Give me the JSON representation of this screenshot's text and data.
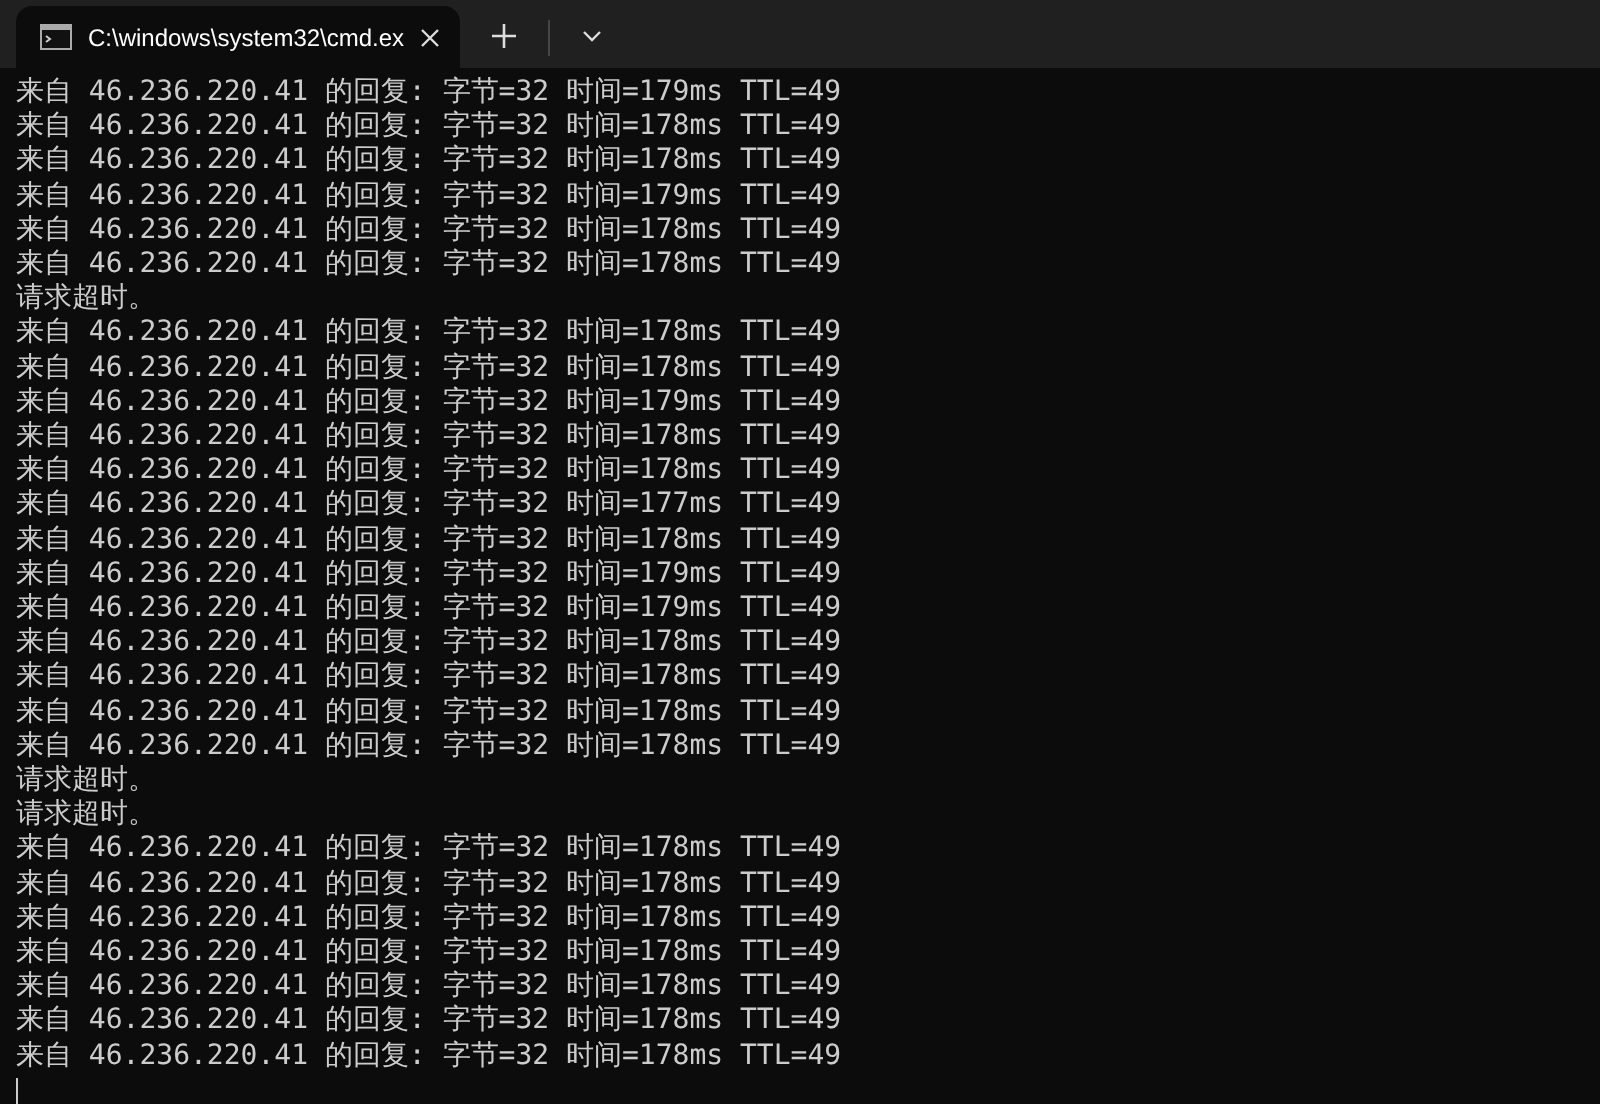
{
  "tabs": [
    {
      "title": "C:\\windows\\system32\\cmd.ex",
      "selected": true
    }
  ],
  "lines": [
    "来自 46.236.220.41 的回复: 字节=32 时间=179ms TTL=49",
    "来自 46.236.220.41 的回复: 字节=32 时间=178ms TTL=49",
    "来自 46.236.220.41 的回复: 字节=32 时间=178ms TTL=49",
    "来自 46.236.220.41 的回复: 字节=32 时间=179ms TTL=49",
    "来自 46.236.220.41 的回复: 字节=32 时间=178ms TTL=49",
    "来自 46.236.220.41 的回复: 字节=32 时间=178ms TTL=49",
    "请求超时。",
    "来自 46.236.220.41 的回复: 字节=32 时间=178ms TTL=49",
    "来自 46.236.220.41 的回复: 字节=32 时间=178ms TTL=49",
    "来自 46.236.220.41 的回复: 字节=32 时间=179ms TTL=49",
    "来自 46.236.220.41 的回复: 字节=32 时间=178ms TTL=49",
    "来自 46.236.220.41 的回复: 字节=32 时间=178ms TTL=49",
    "来自 46.236.220.41 的回复: 字节=32 时间=177ms TTL=49",
    "来自 46.236.220.41 的回复: 字节=32 时间=178ms TTL=49",
    "来自 46.236.220.41 的回复: 字节=32 时间=179ms TTL=49",
    "来自 46.236.220.41 的回复: 字节=32 时间=179ms TTL=49",
    "来自 46.236.220.41 的回复: 字节=32 时间=178ms TTL=49",
    "来自 46.236.220.41 的回复: 字节=32 时间=178ms TTL=49",
    "来自 46.236.220.41 的回复: 字节=32 时间=178ms TTL=49",
    "来自 46.236.220.41 的回复: 字节=32 时间=178ms TTL=49",
    "请求超时。",
    "请求超时。",
    "来自 46.236.220.41 的回复: 字节=32 时间=178ms TTL=49",
    "来自 46.236.220.41 的回复: 字节=32 时间=178ms TTL=49",
    "来自 46.236.220.41 的回复: 字节=32 时间=178ms TTL=49",
    "来自 46.236.220.41 的回复: 字节=32 时间=178ms TTL=49",
    "来自 46.236.220.41 的回复: 字节=32 时间=178ms TTL=49",
    "来自 46.236.220.41 的回复: 字节=32 时间=178ms TTL=49",
    "来自 46.236.220.41 的回复: 字节=32 时间=178ms TTL=49"
  ]
}
